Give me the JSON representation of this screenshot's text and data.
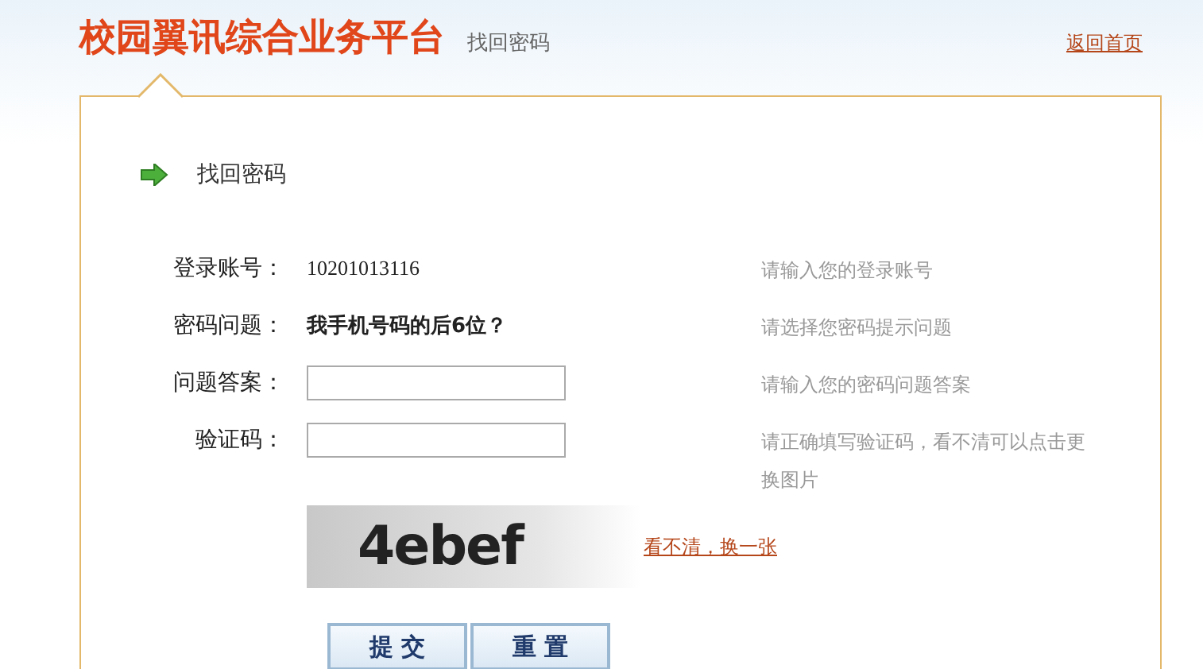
{
  "header": {
    "title": "校园翼讯综合业务平台",
    "subtitle": "找回密码",
    "home_link": "返回首页"
  },
  "panel": {
    "heading": "找回密码",
    "rows": [
      {
        "kind": "text",
        "label": "登录账号：",
        "value": "10201013116",
        "hint": "请输入您的登录账号"
      },
      {
        "kind": "question",
        "label": "密码问题：",
        "value": "我手机号码的后6位？",
        "hint": "请选择您密码提示问题"
      },
      {
        "kind": "input",
        "label": "问题答案：",
        "hint": "请输入您的密码问题答案"
      },
      {
        "kind": "input",
        "label": "验证码：",
        "hint": "请正确填写验证码，看不清可以点击更换图片"
      }
    ],
    "captcha": {
      "code": "4ebef",
      "refresh_link": "看不清，换一张"
    },
    "buttons": [
      "提 交",
      "重 置"
    ]
  }
}
